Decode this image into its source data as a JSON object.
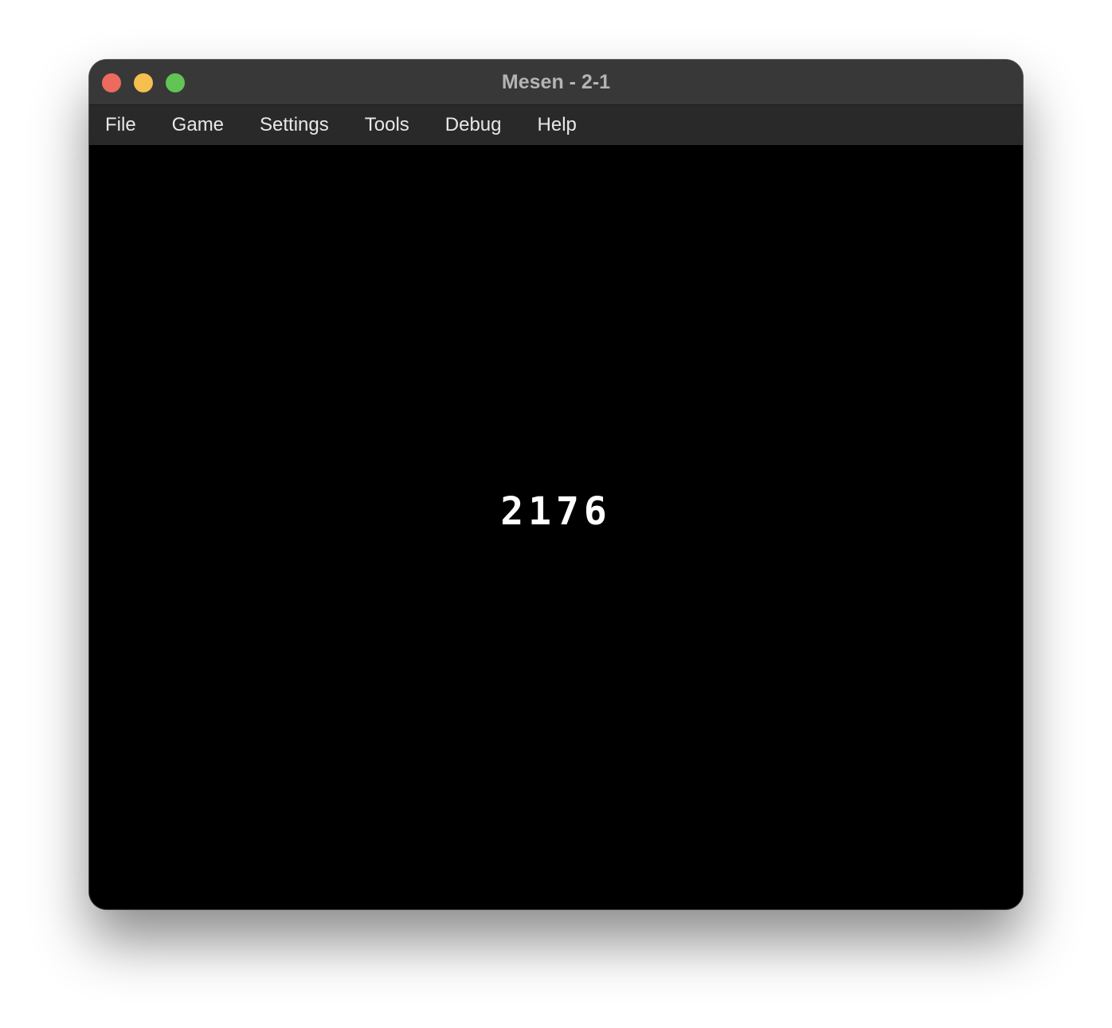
{
  "window": {
    "title": "Mesen - 2-1"
  },
  "menu": {
    "items": [
      {
        "label": "File"
      },
      {
        "label": "Game"
      },
      {
        "label": "Settings"
      },
      {
        "label": "Tools"
      },
      {
        "label": "Debug"
      },
      {
        "label": "Help"
      }
    ]
  },
  "game": {
    "counter": "2176"
  }
}
